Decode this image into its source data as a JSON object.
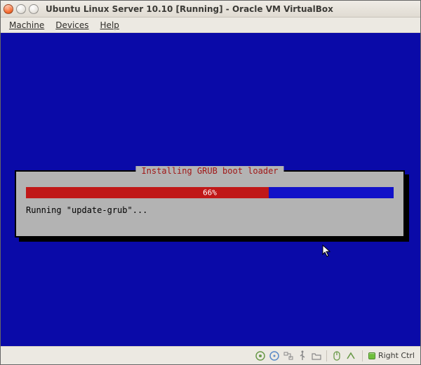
{
  "window": {
    "title": "Ubuntu Linux Server 10.10 [Running] - Oracle VM VirtualBox"
  },
  "menubar": {
    "machine": "Machine",
    "devices": "Devices",
    "help": "Help"
  },
  "installer": {
    "title": "Installing GRUB boot loader",
    "progress_percent": 66,
    "progress_label": "66%",
    "status": "Running \"update-grub\"..."
  },
  "statusbar": {
    "host_key": "Right Ctrl",
    "icons": {
      "hdd": "hard-disk-icon",
      "optical": "optical-drive-icon",
      "network": "network-icon",
      "usb": "usb-icon",
      "shared": "shared-folder-icon",
      "mouse": "mouse-integration-icon"
    }
  },
  "colors": {
    "vm_bg": "#0a0aa8",
    "dlg_bg": "#b3b3b3",
    "progress_fill": "#c01818",
    "progress_track": "#1212c8",
    "dlg_title": "#a01818"
  }
}
